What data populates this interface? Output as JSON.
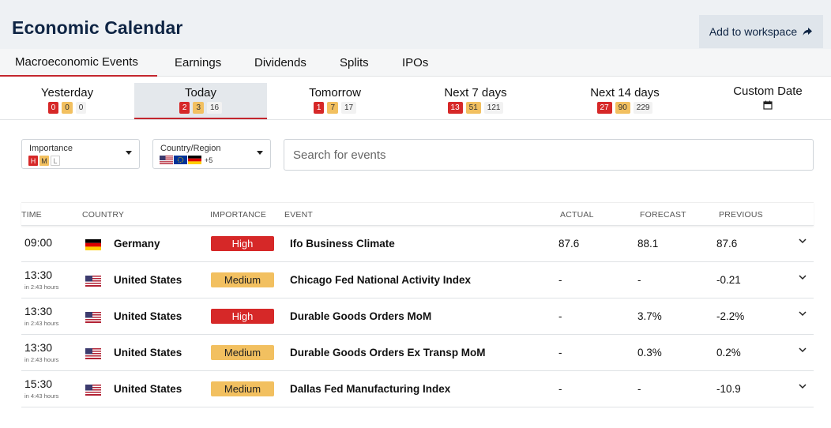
{
  "header": {
    "title": "Economic Calendar",
    "add_workspace_label": "Add to workspace"
  },
  "tabs": [
    {
      "label": "Macroeconomic Events",
      "active": true
    },
    {
      "label": "Earnings",
      "active": false
    },
    {
      "label": "Dividends",
      "active": false
    },
    {
      "label": "Splits",
      "active": false
    },
    {
      "label": "IPOs",
      "active": false
    }
  ],
  "date_ranges": [
    {
      "label": "Yesterday",
      "high": "0",
      "medium": "0",
      "low": "0"
    },
    {
      "label": "Today",
      "high": "2",
      "medium": "3",
      "low": "16",
      "active": true
    },
    {
      "label": "Tomorrow",
      "high": "1",
      "medium": "7",
      "low": "17"
    },
    {
      "label": "Next 7 days",
      "high": "13",
      "medium": "51",
      "low": "121"
    },
    {
      "label": "Next 14 days",
      "high": "27",
      "medium": "90",
      "low": "229"
    },
    {
      "label": "Custom Date",
      "icon": "calendar-icon"
    }
  ],
  "filters": {
    "importance_label": "Importance",
    "importance_levels": [
      "H",
      "M",
      "L"
    ],
    "country_label": "Country/Region",
    "country_more": "+5",
    "search_placeholder": "Search for events"
  },
  "table": {
    "columns": {
      "time": "TIME",
      "country": "COUNTRY",
      "importance": "IMPORTANCE",
      "event": "EVENT",
      "actual": "ACTUAL",
      "forecast": "FORECAST",
      "previous": "PREVIOUS"
    },
    "rows": [
      {
        "time": "09:00",
        "sub": "",
        "country": "Germany",
        "flag": "de",
        "importance": "High",
        "event": "Ifo Business Climate",
        "actual": "87.6",
        "forecast": "88.1",
        "previous": "87.6"
      },
      {
        "time": "13:30",
        "sub": "in 2:43 hours",
        "country": "United States",
        "flag": "us",
        "importance": "Medium",
        "event": "Chicago Fed National Activity Index",
        "actual": "-",
        "forecast": "-",
        "previous": "-0.21"
      },
      {
        "time": "13:30",
        "sub": "in 2:43 hours",
        "country": "United States",
        "flag": "us",
        "importance": "High",
        "event": "Durable Goods Orders MoM",
        "actual": "-",
        "forecast": "3.7%",
        "previous": "-2.2%"
      },
      {
        "time": "13:30",
        "sub": "in 2:43 hours",
        "country": "United States",
        "flag": "us",
        "importance": "Medium",
        "event": "Durable Goods Orders Ex Transp MoM",
        "actual": "-",
        "forecast": "0.3%",
        "previous": "0.2%"
      },
      {
        "time": "15:30",
        "sub": "in 4:43 hours",
        "country": "United States",
        "flag": "us",
        "importance": "Medium",
        "event": "Dallas Fed Manufacturing Index",
        "actual": "-",
        "forecast": "-",
        "previous": "-10.9"
      }
    ]
  },
  "colors": {
    "high": "#d62828",
    "medium": "#f2c060",
    "accent": "#c3262e",
    "title": "#0f2544"
  }
}
